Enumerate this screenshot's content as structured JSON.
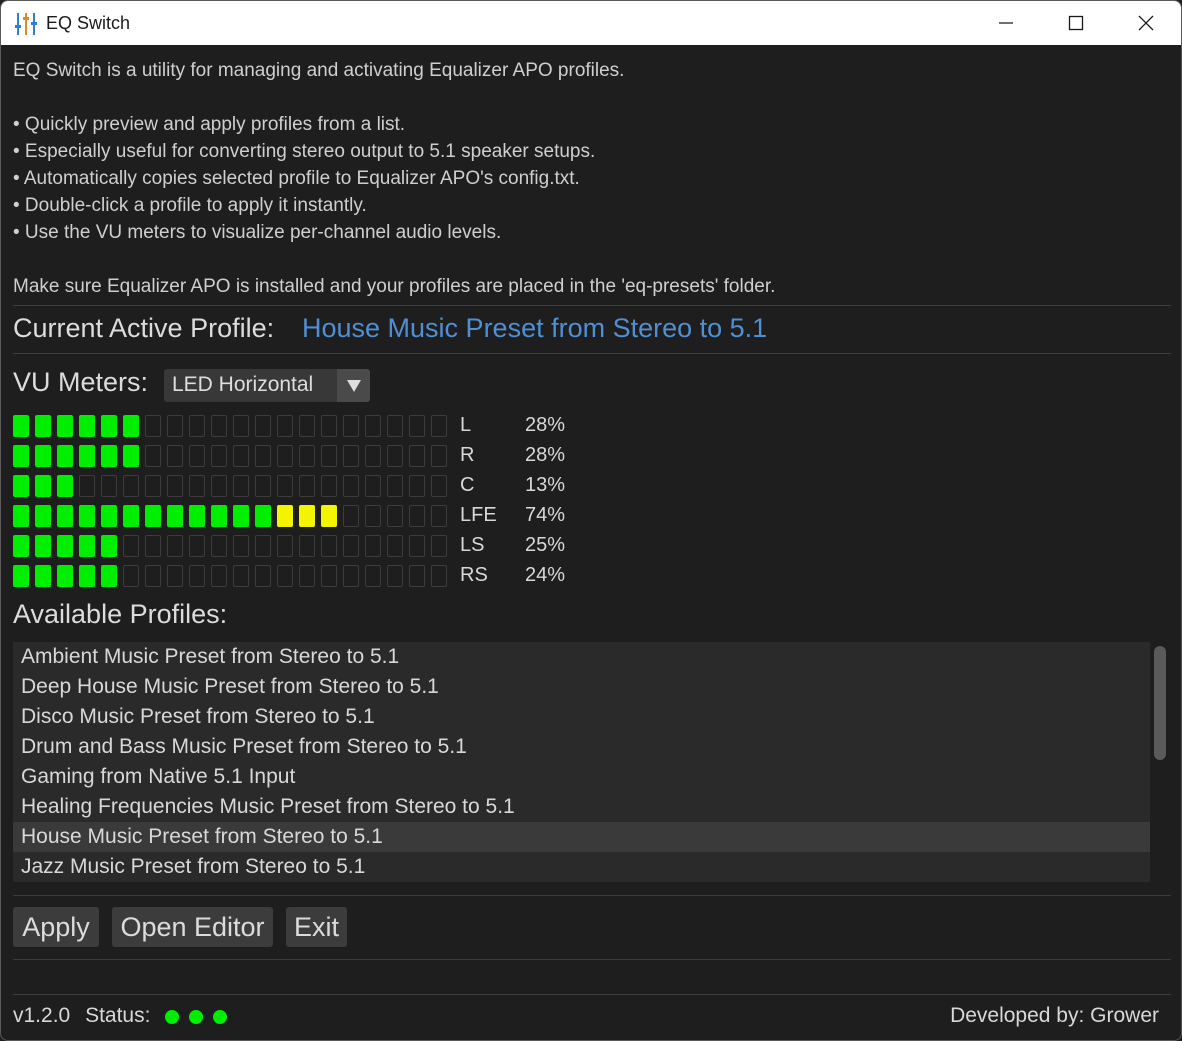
{
  "window": {
    "title": "EQ Switch",
    "icon": "equalizer-sliders-icon",
    "controls": [
      "minimize-icon",
      "maximize-icon",
      "close-icon"
    ]
  },
  "description": {
    "intro": "EQ Switch is a utility for managing and activating Equalizer APO profiles.",
    "bullets": [
      "• Quickly preview and apply profiles from a list.",
      "• Especially useful for converting stereo output to 5.1 speaker setups.",
      "• Automatically copies selected profile to Equalizer APO's config.txt.",
      "• Double-click a profile to apply it instantly.",
      "• Use the VU meters to visualize per-channel audio levels."
    ],
    "note": "Make sure Equalizer APO is installed and your profiles are placed in the 'eq-presets' folder."
  },
  "active_profile": {
    "label": "Current Active Profile:",
    "value": "House Music Preset from Stereo to 5.1",
    "color": "#4f8fd4"
  },
  "vu": {
    "label": "VU Meters:",
    "mode": "LED Horizontal",
    "segments": 20,
    "colors": {
      "green": "#00ee00",
      "yellow": "#f4f400"
    },
    "channels": [
      {
        "name": "L",
        "percent": "28%",
        "lit": 6,
        "yellow_from": 12
      },
      {
        "name": "R",
        "percent": "28%",
        "lit": 6,
        "yellow_from": 12
      },
      {
        "name": "C",
        "percent": "13%",
        "lit": 3,
        "yellow_from": 12
      },
      {
        "name": "LFE",
        "percent": "74%",
        "lit": 15,
        "yellow_from": 12
      },
      {
        "name": "LS",
        "percent": "25%",
        "lit": 5,
        "yellow_from": 12
      },
      {
        "name": "RS",
        "percent": "24%",
        "lit": 5,
        "yellow_from": 12
      }
    ]
  },
  "profiles": {
    "label": "Available Profiles:",
    "items": [
      "Ambient Music Preset from Stereo to 5.1",
      "Deep House Music Preset from Stereo to 5.1",
      "Disco Music Preset from Stereo to 5.1",
      "Drum and Bass Music Preset from Stereo to 5.1",
      "Gaming from Native 5.1 Input",
      "Healing Frequencies Music Preset from Stereo to 5.1",
      "House Music Preset from Stereo to 5.1",
      "Jazz Music Preset from Stereo to 5.1"
    ],
    "selected_index": 6
  },
  "buttons": {
    "apply": "Apply",
    "open_editor": "Open Editor",
    "exit": "Exit"
  },
  "footer": {
    "version": "v1.2.0",
    "status_label": "Status:",
    "status_dot_color": "#00ee00",
    "developer": "Developed by: Grower"
  }
}
